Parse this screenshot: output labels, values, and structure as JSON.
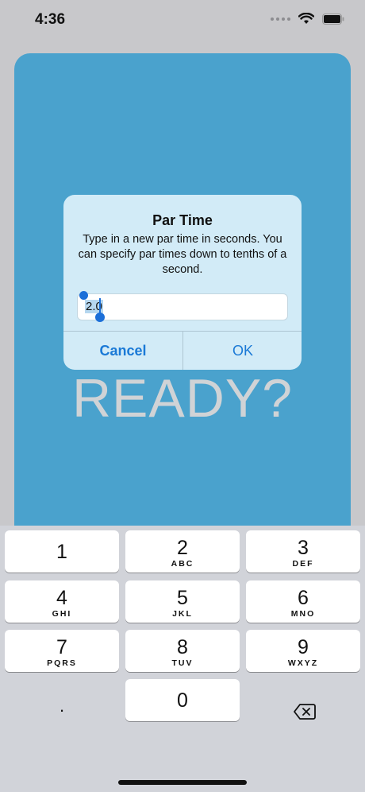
{
  "status_bar": {
    "time": "4:36"
  },
  "main": {
    "ready_text": "READY?"
  },
  "dialog": {
    "title": "Par Time",
    "message": "Type in a new par time in seconds. You can specify par times down to tenths of a second.",
    "input_value": "2.0",
    "cancel_label": "Cancel",
    "ok_label": "OK"
  },
  "keyboard": {
    "keys": [
      {
        "digit": "1",
        "letters": ""
      },
      {
        "digit": "2",
        "letters": "ABC"
      },
      {
        "digit": "3",
        "letters": "DEF"
      },
      {
        "digit": "4",
        "letters": "GHI"
      },
      {
        "digit": "5",
        "letters": "JKL"
      },
      {
        "digit": "6",
        "letters": "MNO"
      },
      {
        "digit": "7",
        "letters": "PQRS"
      },
      {
        "digit": "8",
        "letters": "TUV"
      },
      {
        "digit": "9",
        "letters": "WXYZ"
      },
      {
        "digit": "0",
        "letters": ""
      }
    ],
    "decimal_label": ".",
    "delete_icon": "backspace-icon"
  },
  "colors": {
    "card": "#4aa2cd",
    "dialog": "#d2ebf7",
    "accent": "#1a79d6",
    "ready_text": "#d0d3d6"
  }
}
